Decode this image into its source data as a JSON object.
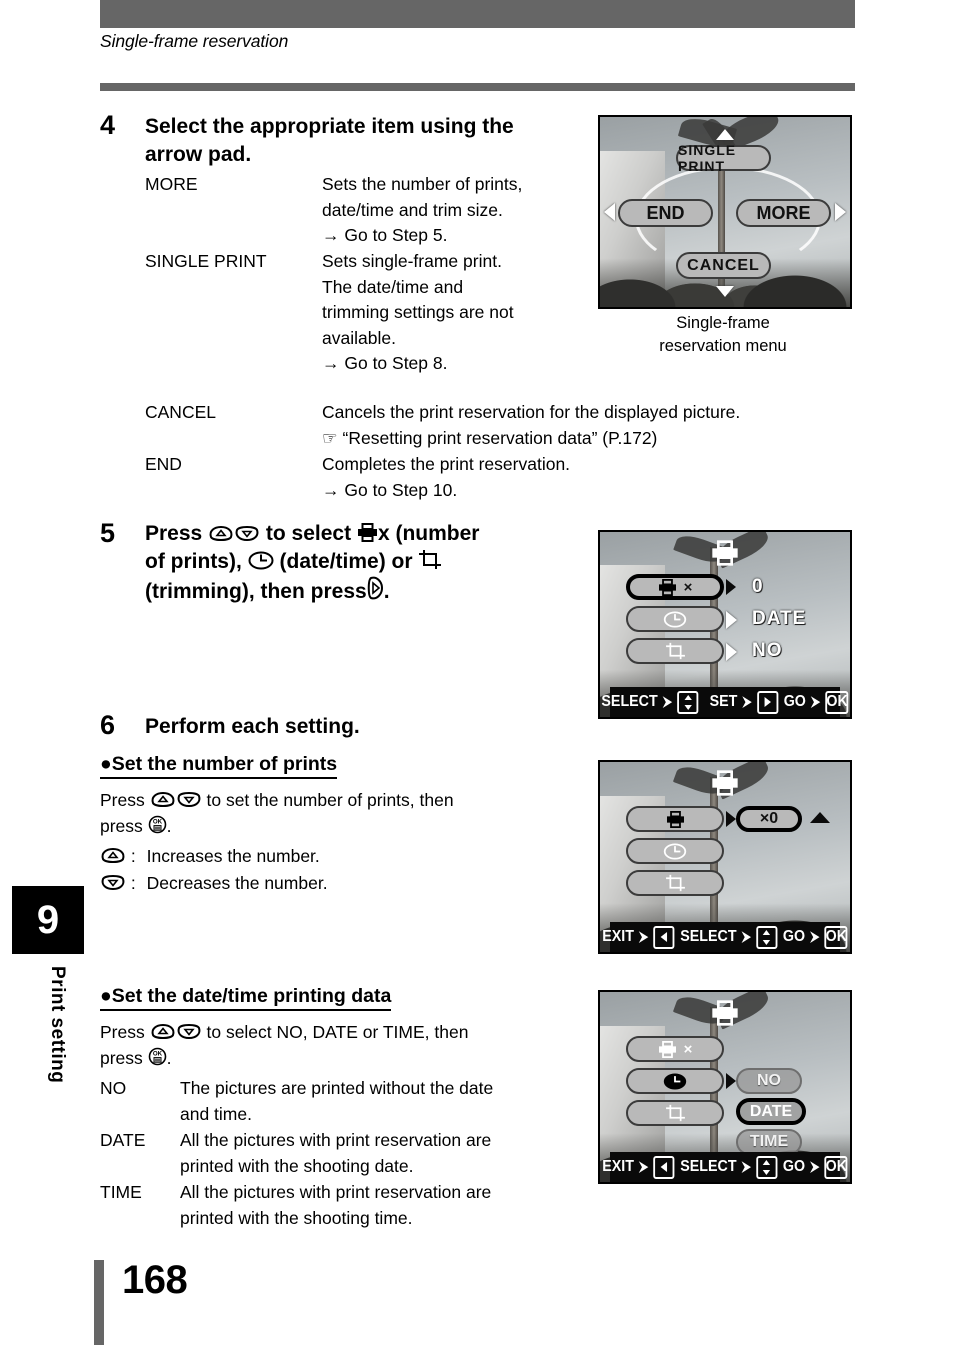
{
  "page": {
    "running_head": "Single-frame reservation",
    "folio": "168",
    "chapter_number": "9",
    "chapter_label": "Print setting",
    "rule_color": "#666666"
  },
  "steps": [
    {
      "number": "4",
      "title": "Select the appropriate item using the arrow pad.",
      "definitions": [
        {
          "term": "MORE",
          "lines": [
            "Sets the number of prints,",
            "date/time and trim size.",
            "→ Go to Step 5."
          ]
        },
        {
          "term": "SINGLE PRINT",
          "lines": [
            "Sets single-frame print.",
            "The date/time and",
            "trimming settings are not",
            "available.",
            "→ Go to Step 8."
          ]
        },
        {
          "term": "CANCEL",
          "lines": [
            "Cancels the print reservation for the displayed picture.",
            "☞ “Resetting print reservation data” (P.172)"
          ]
        },
        {
          "term": "END",
          "lines": [
            "Completes the print reservation.",
            "→ Go to Step 10."
          ]
        }
      ]
    },
    {
      "number": "5",
      "title_parts": {
        "l1a": "Press",
        "l1b": "to select",
        "l1c": "x (number",
        "l2a": "of prints),",
        "l2b": "(date/time) or",
        "l3a": "(trimming), then press",
        "l3b": "."
      }
    },
    {
      "number": "6",
      "title": "Perform each setting."
    }
  ],
  "sections": [
    {
      "heading": "●Set the number of prints",
      "paragraph": {
        "l1a": "Press",
        "l1b": "to set the number of prints, then",
        "l2a": "press",
        "l2b": "."
      },
      "keys": [
        {
          "action": "Increases the number.",
          "icon": "arrow-up-pad-icon"
        },
        {
          "action": "Decreases the number.",
          "icon": "arrow-down-pad-icon"
        }
      ]
    },
    {
      "heading": "●Set the date/time printing data",
      "paragraph": {
        "l1a": "Press",
        "l1b": "to select NO, DATE or TIME, then",
        "l2a": "press",
        "l2b": "."
      },
      "definitions": [
        {
          "term": "NO",
          "lines": [
            "The pictures are printed without the date",
            "and time."
          ]
        },
        {
          "term": "DATE",
          "lines": [
            "All the pictures with print reservation are",
            "printed with the shooting date."
          ]
        },
        {
          "term": "TIME",
          "lines": [
            "All the pictures with print reservation are",
            "printed with the shooting time."
          ]
        }
      ]
    }
  ],
  "screens": [
    {
      "id": "single-frame-reservation-menu",
      "caption_line1": "Single-frame",
      "caption_line2": "reservation menu",
      "buttons": {
        "top": "SINGLE PRINT",
        "left": "END",
        "right": "MORE",
        "bottom": "CANCEL"
      }
    },
    {
      "id": "more-settings-overview",
      "rows": [
        {
          "icon": "printer-count-icon",
          "value": "0",
          "selected": true
        },
        {
          "icon": "clock-icon",
          "value": "DATE",
          "selected": false
        },
        {
          "icon": "trim-icon",
          "value": "NO",
          "selected": false
        }
      ],
      "statusbar": [
        {
          "label": "SELECT",
          "arrow": "⮞",
          "key": "updown"
        },
        {
          "label": "SET",
          "arrow": "⮞",
          "key": "right"
        },
        {
          "label": "GO",
          "arrow": "⮞",
          "key": "OK"
        }
      ]
    },
    {
      "id": "number-of-prints-screen",
      "rows": [
        {
          "icon": "printer-icon",
          "selected": false
        },
        {
          "icon": "clock-icon",
          "selected": false
        },
        {
          "icon": "trim-icon",
          "selected": false
        }
      ],
      "value_pill": "×0",
      "statusbar": [
        {
          "label": "EXIT",
          "arrow": "⮞",
          "key": "left"
        },
        {
          "label": "SELECT",
          "arrow": "⮞",
          "key": "updown"
        },
        {
          "label": "GO",
          "arrow": "⮞",
          "key": "OK"
        }
      ]
    },
    {
      "id": "date-time-screen",
      "rows": [
        {
          "icon": "printer-count-icon",
          "selected": false
        },
        {
          "icon": "clock-icon",
          "selected": true
        },
        {
          "icon": "trim-icon",
          "selected": false
        }
      ],
      "options": [
        {
          "label": "NO",
          "selected": false
        },
        {
          "label": "DATE",
          "selected": true
        },
        {
          "label": "TIME",
          "selected": false
        }
      ],
      "statusbar": [
        {
          "label": "EXIT",
          "arrow": "⮞",
          "key": "left"
        },
        {
          "label": "SELECT",
          "arrow": "⮞",
          "key": "updown"
        },
        {
          "label": "GO",
          "arrow": "⮞",
          "key": "OK"
        }
      ]
    }
  ]
}
